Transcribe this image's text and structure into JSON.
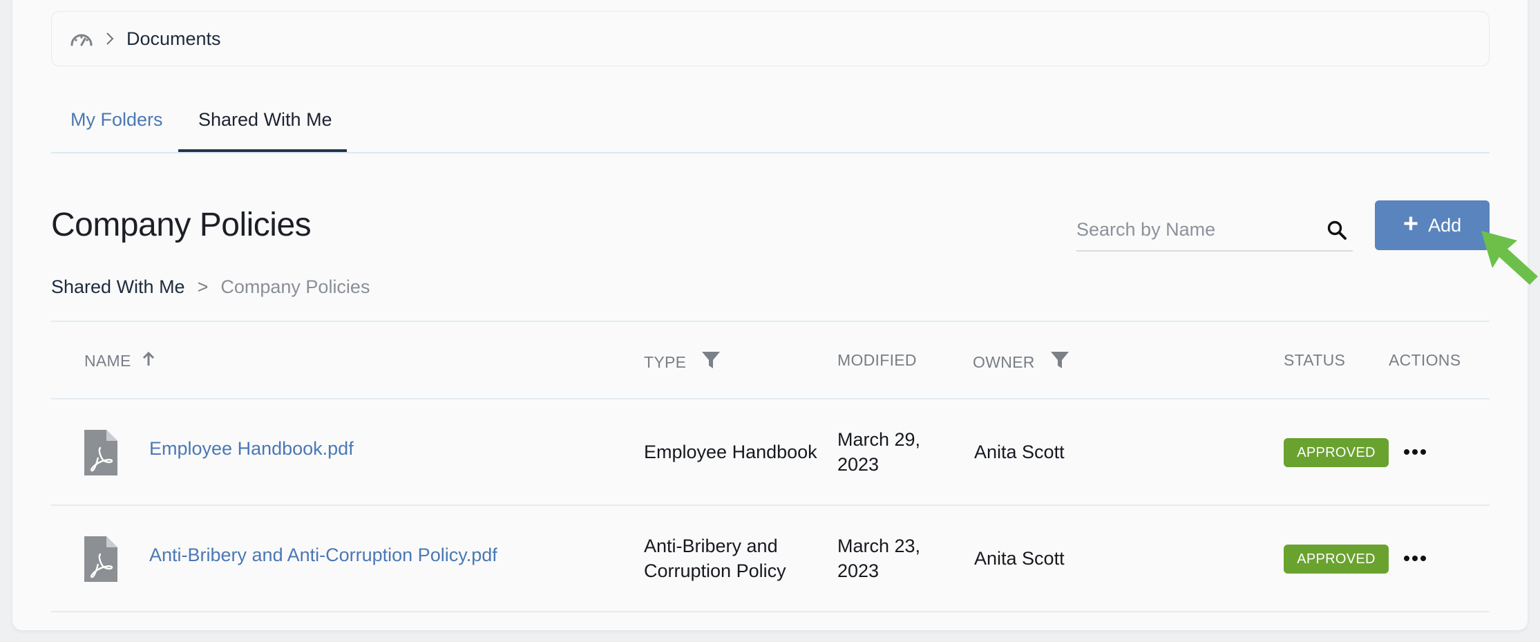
{
  "breadcrumb": {
    "current": "Documents"
  },
  "tabs": [
    {
      "label": "My Folders",
      "active": false
    },
    {
      "label": "Shared With Me",
      "active": true
    }
  ],
  "page": {
    "title": "Company Policies"
  },
  "search": {
    "placeholder": "Search by Name",
    "value": ""
  },
  "add_button": {
    "label": "Add"
  },
  "sub_breadcrumb": {
    "parent": "Shared With Me",
    "separator": ">",
    "current": "Company Policies"
  },
  "table": {
    "columns": {
      "name": "NAME",
      "type": "TYPE",
      "modified": "MODIFIED",
      "owner": "OWNER",
      "status": "STATUS",
      "actions": "ACTIONS"
    },
    "sort": {
      "column": "name",
      "direction": "ascending"
    },
    "rows": [
      {
        "name": "Employee Handbook.pdf",
        "type_line1": "Employee Handbook",
        "type_line2": "",
        "modified_line1": "March 29,",
        "modified_line2": "2023",
        "owner": "Anita Scott",
        "status": "APPROVED"
      },
      {
        "name": "Anti-Bribery and Anti-Corruption Policy.pdf",
        "type_line1": "Anti-Bribery and",
        "type_line2": "Corruption Policy",
        "modified_line1": "March 23,",
        "modified_line2": "2023",
        "owner": "Anita Scott",
        "status": "APPROVED"
      }
    ]
  },
  "colors": {
    "accent": "#5a84bd",
    "link": "#4a78b5",
    "status_approved": "#6aa22f",
    "cursor": "#6cc04a"
  },
  "icons": [
    "dashboard-icon",
    "chevron-right-icon",
    "search-icon",
    "plus-icon",
    "arrow-up-icon",
    "filter-icon",
    "pdf-file-icon",
    "more-horizontal-icon",
    "cursor-arrow-icon"
  ]
}
